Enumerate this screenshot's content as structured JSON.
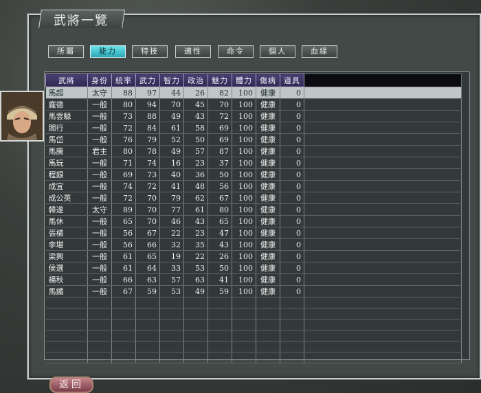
{
  "window": {
    "title": "武將一覽"
  },
  "tabs": [
    {
      "label": "所屬",
      "active": false
    },
    {
      "label": "能力",
      "active": true
    },
    {
      "label": "特技",
      "active": false
    },
    {
      "label": "適性",
      "active": false
    },
    {
      "label": "命令",
      "active": false
    },
    {
      "label": "個人",
      "active": false
    },
    {
      "label": "血緣",
      "active": false
    }
  ],
  "table": {
    "headers": [
      "武將",
      "身份",
      "統率",
      "武力",
      "智力",
      "政治",
      "魅力",
      "體力",
      "傷病",
      "道具"
    ],
    "rows": [
      [
        "馬超",
        "太守",
        "88",
        "97",
        "44",
        "26",
        "82",
        "100",
        "健康",
        "0"
      ],
      [
        "龐德",
        "一般",
        "80",
        "94",
        "70",
        "45",
        "70",
        "100",
        "健康",
        "0"
      ],
      [
        "馬雲騄",
        "一般",
        "73",
        "88",
        "49",
        "43",
        "72",
        "100",
        "健康",
        "0"
      ],
      [
        "閻行",
        "一般",
        "72",
        "84",
        "61",
        "58",
        "69",
        "100",
        "健康",
        "0"
      ],
      [
        "馬岱",
        "一般",
        "76",
        "79",
        "52",
        "50",
        "69",
        "100",
        "健康",
        "0"
      ],
      [
        "馬騰",
        "君主",
        "80",
        "78",
        "49",
        "57",
        "87",
        "100",
        "健康",
        "0"
      ],
      [
        "馬玩",
        "一般",
        "71",
        "74",
        "16",
        "23",
        "37",
        "100",
        "健康",
        "0"
      ],
      [
        "程銀",
        "一般",
        "69",
        "73",
        "40",
        "36",
        "50",
        "100",
        "健康",
        "0"
      ],
      [
        "成宜",
        "一般",
        "74",
        "72",
        "41",
        "48",
        "56",
        "100",
        "健康",
        "0"
      ],
      [
        "成公英",
        "一般",
        "72",
        "70",
        "79",
        "62",
        "67",
        "100",
        "健康",
        "0"
      ],
      [
        "韓遂",
        "太守",
        "89",
        "70",
        "77",
        "61",
        "80",
        "100",
        "健康",
        "0"
      ],
      [
        "馬休",
        "一般",
        "65",
        "70",
        "46",
        "43",
        "65",
        "100",
        "健康",
        "0"
      ],
      [
        "張橫",
        "一般",
        "56",
        "67",
        "22",
        "23",
        "47",
        "100",
        "健康",
        "0"
      ],
      [
        "李堪",
        "一般",
        "56",
        "66",
        "32",
        "35",
        "43",
        "100",
        "健康",
        "0"
      ],
      [
        "梁興",
        "一般",
        "61",
        "65",
        "19",
        "22",
        "26",
        "100",
        "健康",
        "0"
      ],
      [
        "侯選",
        "一般",
        "61",
        "64",
        "33",
        "53",
        "50",
        "100",
        "健康",
        "0"
      ],
      [
        "楊秋",
        "一般",
        "66",
        "63",
        "57",
        "63",
        "41",
        "100",
        "健康",
        "0"
      ],
      [
        "馬鐵",
        "一般",
        "67",
        "59",
        "53",
        "49",
        "59",
        "100",
        "健康",
        "0"
      ]
    ],
    "selected_row": 0
  },
  "footer": {
    "back_label": "返回"
  },
  "portrait": {
    "icon": "officer-portrait-icon"
  },
  "colors": {
    "active_tab": "#2aa9b6",
    "header_bg": "#2f2850",
    "selected_row": "#bfc6c6"
  }
}
